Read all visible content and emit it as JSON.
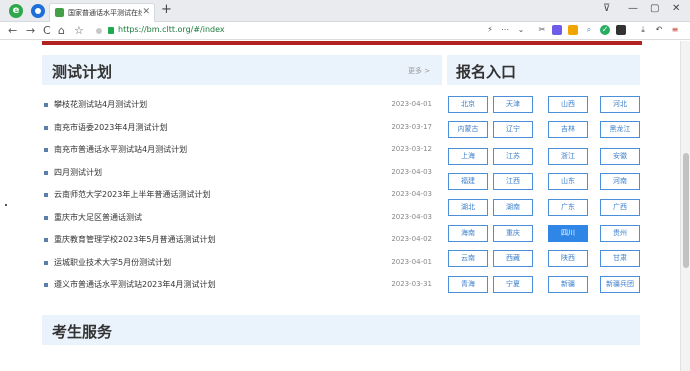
{
  "browser": {
    "tab_title": "国家普通话水平测试在线报名",
    "new_tab": "+",
    "url": "https://bm.cltt.org/#/index",
    "nav": {
      "back": "←",
      "forward": "→",
      "reload": "C",
      "home": "⌂",
      "star": "☆"
    },
    "win": {
      "min": "—",
      "max": "▢",
      "close": "✕",
      "menu_left": "⊽"
    },
    "toolbar_icons": [
      "lightning-icon",
      "more-icon",
      "dropdown-icon",
      "cut-icon",
      "extension-icon",
      "shield-icon",
      "search-icon",
      "check-icon",
      "grid-icon",
      "download-icon",
      "undo-icon",
      "menu-icon"
    ]
  },
  "plans": {
    "title": "测试计划",
    "more": "更多 >",
    "items": [
      {
        "text": "攀枝花测试站4月测试计划",
        "date": "2023-04-01"
      },
      {
        "text": "南充市语委2023年4月测试计划",
        "date": "2023-03-17"
      },
      {
        "text": "南充市普通话水平测试站4月测试计划",
        "date": "2023-03-12"
      },
      {
        "text": "四月测试计划",
        "date": "2023-04-03"
      },
      {
        "text": "云南师范大学2023年上半年普通话测试计划",
        "date": "2023-04-03"
      },
      {
        "text": "重庆市大足区普通话测试",
        "date": "2023-04-03"
      },
      {
        "text": "重庆教育管理学校2023年5月普通话测试计划",
        "date": "2023-04-02"
      },
      {
        "text": "运城职业技术大学5月份测试计划",
        "date": "2023-04-01"
      },
      {
        "text": "遵义市普通话水平测试站2023年4月测试计划",
        "date": "2023-03-31"
      }
    ]
  },
  "signup": {
    "title": "报名入口",
    "provinces": [
      "北京",
      "天津",
      "山西",
      "河北",
      "内蒙古",
      "辽宁",
      "吉林",
      "黑龙江",
      "上海",
      "江苏",
      "浙江",
      "安徽",
      "福建",
      "江西",
      "山东",
      "河南",
      "湖北",
      "湖南",
      "广东",
      "广西",
      "海南",
      "重庆",
      "四川",
      "贵州",
      "云南",
      "西藏",
      "陕西",
      "甘肃",
      "青海",
      "宁夏",
      "新疆",
      "新疆兵团"
    ],
    "active": "四川"
  },
  "services": {
    "title": "考生服务"
  },
  "colors": {
    "accent": "#2f86e6",
    "redbar": "#b22222",
    "panel_bg": "#eaf2fb"
  }
}
